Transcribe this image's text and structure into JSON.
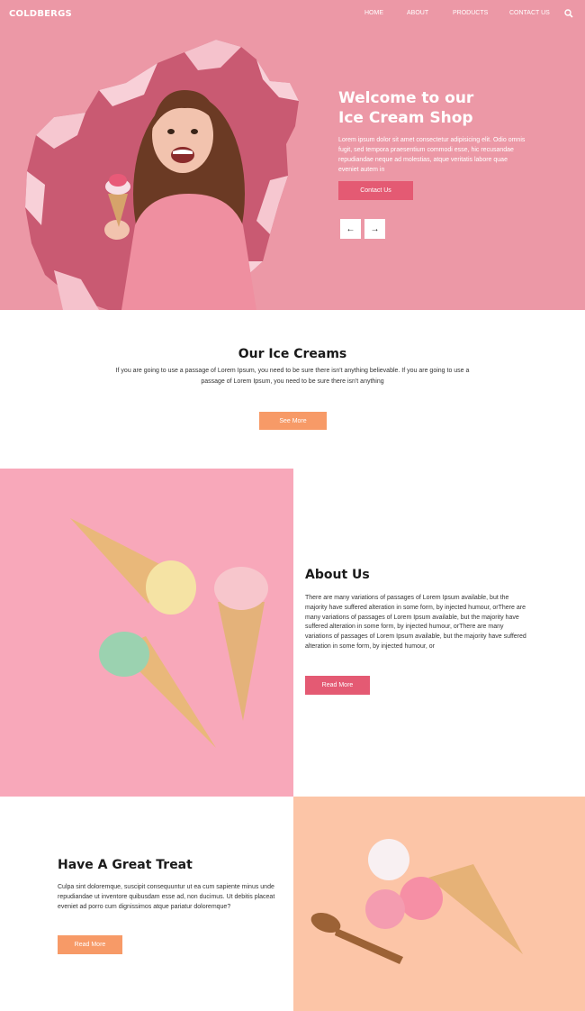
{
  "brand": "COLDBERGS",
  "nav": {
    "items": [
      "HOME",
      "ABOUT",
      "PRODUCTS",
      "CONTACT US"
    ],
    "search_icon": "search-icon"
  },
  "hero": {
    "title_line1": "Welcome to our",
    "title_line2": "Ice Cream Shop",
    "text": "Lorem ipsum dolor sit amet consectetur adipisicing elit. Odio omnis fugit, sed tempora praesentium commodi esse, hic recusandae repudiandae neque ad molestias, atque veritatis labore quae eveniet autem in",
    "contact_label": "Contact Us",
    "prev_arrow": "←",
    "next_arrow": "→",
    "bg_color": "#ec98a6"
  },
  "ice_creams": {
    "title": "Our Ice Creams",
    "text": "If you are going to use a passage of Lorem Ipsum, you need to be sure there isn't anything believable. If you are going to use a passage of Lorem Ipsum, you need to be sure there isn't anything",
    "button_label": "See More"
  },
  "about": {
    "title": "About Us",
    "text": "There are many variations of passages of Lorem Ipsum available, but the majority have suffered alteration in some form, by injected humour, orThere are many variations of passages of Lorem Ipsum available, but the majority have suffered alteration in some form, by injected humour, orThere are many variations of passages of Lorem Ipsum available, but the majority have suffered alteration in some form, by injected humour, or",
    "button_label": "Read More",
    "bg_color": "#f8a8ba"
  },
  "treat": {
    "title": "Have A Great Treat",
    "text": "Culpa sint doloremque, suscipit consequuntur ut ea cum sapiente minus unde repudiandae ut inventore quibusdam esse ad, non ducimus. Ut debitis placeat eveniet ad porro cum dignissimos atque pariatur doloremque?",
    "button_label": "Read More",
    "bg_color": "#fcc5a7"
  },
  "colors": {
    "primary_pink": "#e45a73",
    "orange": "#f79a67"
  }
}
